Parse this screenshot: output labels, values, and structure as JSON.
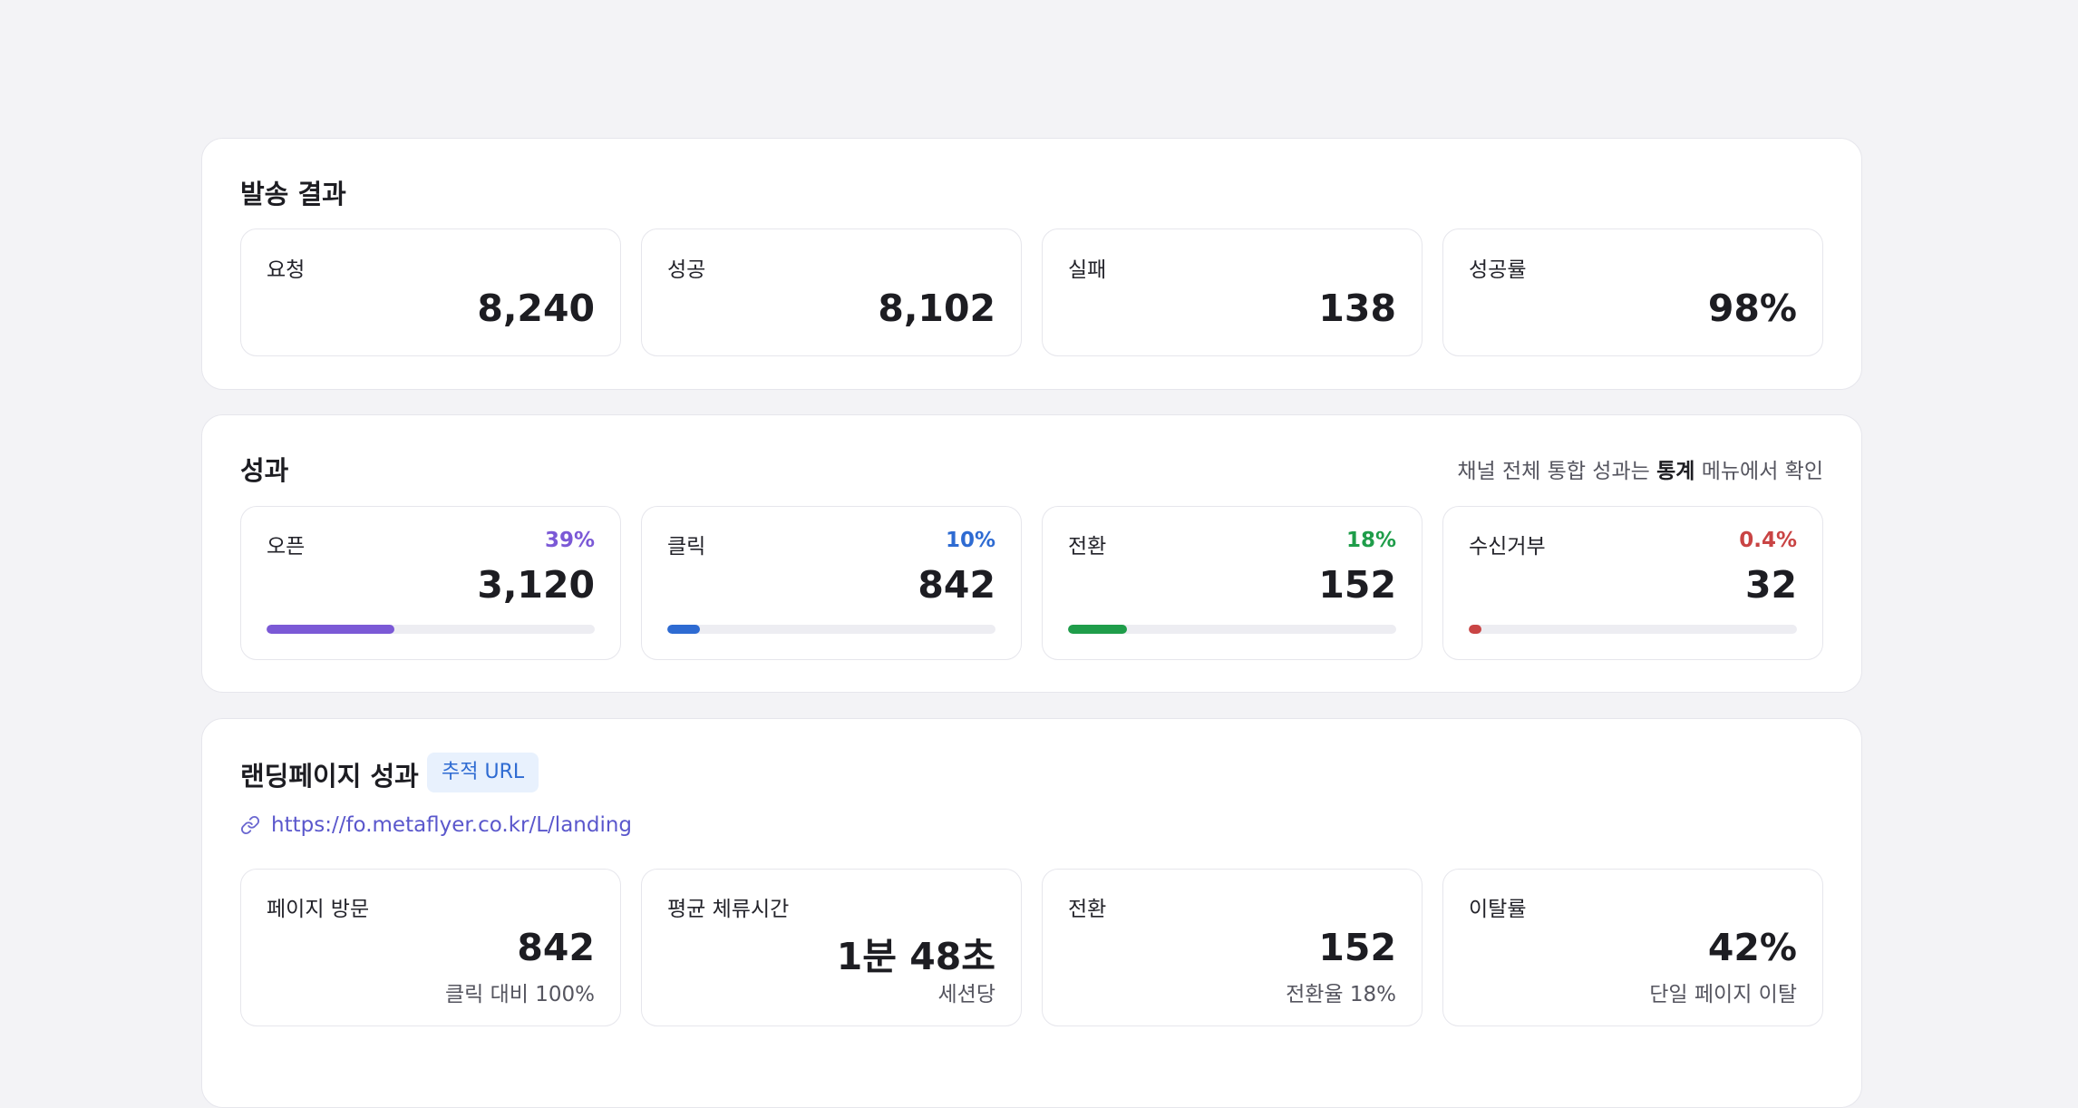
{
  "send_result": {
    "title": "발송 결과",
    "cards": [
      {
        "label": "요청",
        "value": "8,240"
      },
      {
        "label": "성공",
        "value": "8,102"
      },
      {
        "label": "실패",
        "value": "138"
      },
      {
        "label": "성공률",
        "value": "98%"
      }
    ]
  },
  "performance": {
    "title": "성과",
    "note_prefix": "채널 전체 통합 성과는 ",
    "note_bold": "통계",
    "note_suffix": " 메뉴에서 확인",
    "cards": [
      {
        "label": "오픈",
        "pct": "39%",
        "value": "3,120",
        "progress": 0.39,
        "color": "#7b59d6"
      },
      {
        "label": "클릭",
        "pct": "10%",
        "value": "842",
        "progress": 0.1,
        "color": "#2e6bd2"
      },
      {
        "label": "전환",
        "pct": "18%",
        "value": "152",
        "progress": 0.18,
        "color": "#1f9d4a"
      },
      {
        "label": "수신거부",
        "pct": "0.4%",
        "value": "32",
        "progress": 0.04,
        "color": "#c94444"
      }
    ]
  },
  "landing": {
    "title": "랜딩페이지 성과",
    "tag": "추적 URL",
    "url": "https://fo.metaflyer.co.kr/L/landing",
    "link_icon": "link-icon",
    "cards": [
      {
        "label": "페이지 방문",
        "value": "842",
        "sub": "클릭 대비 100%"
      },
      {
        "label": "평균 체류시간",
        "value": "1분 48초",
        "sub": "세션당"
      },
      {
        "label": "전환",
        "value": "152",
        "sub": "전환율 18%"
      },
      {
        "label": "이탈률",
        "value": "42%",
        "sub": "단일 페이지 이탈"
      }
    ]
  }
}
